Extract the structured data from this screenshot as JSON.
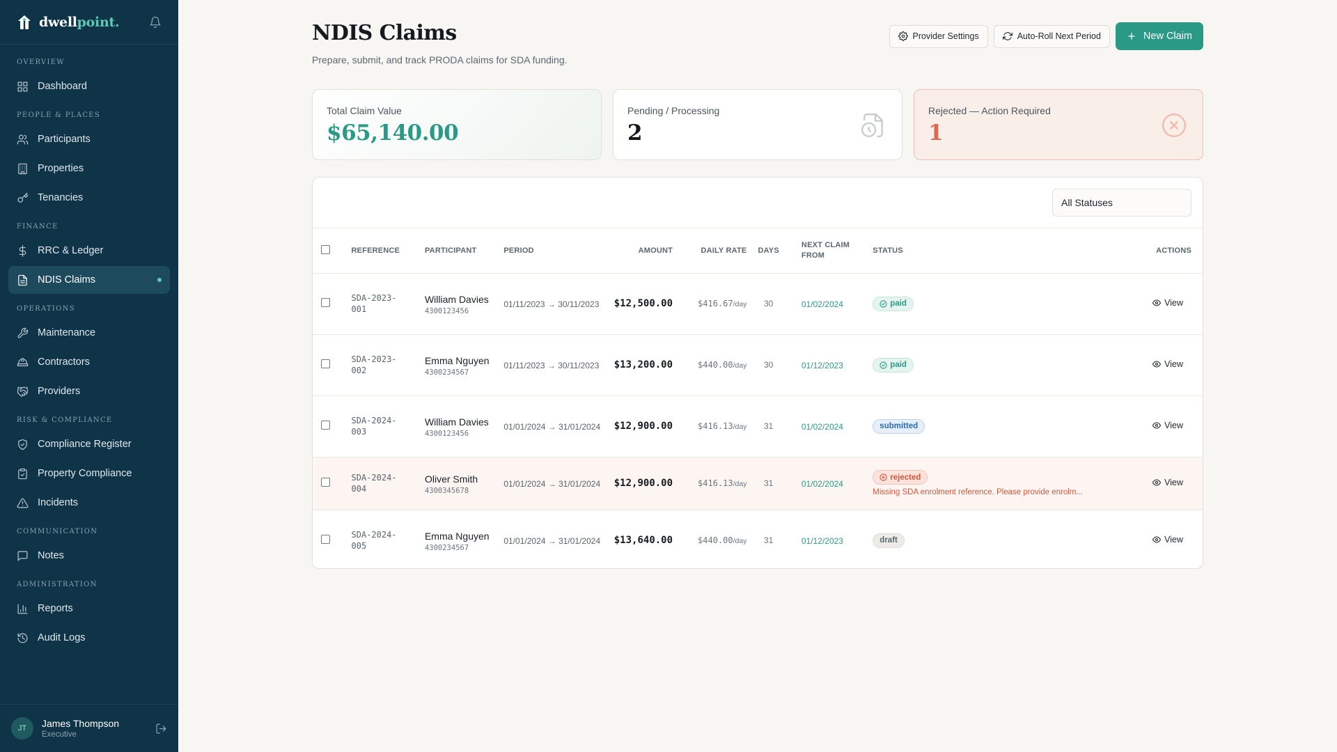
{
  "app": {
    "brand_primary": "dwell",
    "brand_accent": "point.",
    "colors": {
      "sidebar": "#0f3347",
      "accent": "#2a9a87",
      "danger": "#dd6a50"
    }
  },
  "sidebar": {
    "sections": [
      {
        "title": "OVERVIEW",
        "items": [
          {
            "label": "Dashboard",
            "icon": "grid-icon"
          }
        ]
      },
      {
        "title": "PEOPLE & PLACES",
        "items": [
          {
            "label": "Participants",
            "icon": "users-icon"
          },
          {
            "label": "Properties",
            "icon": "building-icon"
          },
          {
            "label": "Tenancies",
            "icon": "key-icon"
          }
        ]
      },
      {
        "title": "FINANCE",
        "items": [
          {
            "label": "RRC & Ledger",
            "icon": "dollar-icon"
          },
          {
            "label": "NDIS Claims",
            "icon": "document-icon",
            "active": true
          }
        ]
      },
      {
        "title": "OPERATIONS",
        "items": [
          {
            "label": "Maintenance",
            "icon": "wrench-icon"
          },
          {
            "label": "Contractors",
            "icon": "hardhat-icon"
          },
          {
            "label": "Providers",
            "icon": "handshake-icon"
          }
        ]
      },
      {
        "title": "RISK & COMPLIANCE",
        "items": [
          {
            "label": "Compliance Register",
            "icon": "shield-icon"
          },
          {
            "label": "Property Compliance",
            "icon": "clipboard-icon"
          },
          {
            "label": "Incidents",
            "icon": "warning-icon"
          }
        ]
      },
      {
        "title": "COMMUNICATION",
        "items": [
          {
            "label": "Notes",
            "icon": "message-icon"
          }
        ]
      },
      {
        "title": "ADMINISTRATION",
        "items": [
          {
            "label": "Reports",
            "icon": "bar-chart-icon"
          },
          {
            "label": "Audit Logs",
            "icon": "history-icon"
          }
        ]
      }
    ],
    "user": {
      "initials": "JT",
      "name": "James Thompson",
      "role": "Executive"
    }
  },
  "header": {
    "title": "NDIS Claims",
    "subtitle": "Prepare, submit, and track PRODA claims for SDA funding.",
    "btn_provider": "Provider Settings",
    "btn_autoroll": "Auto-Roll Next Period",
    "btn_new": "New Claim"
  },
  "cards": {
    "total_label": "Total Claim Value",
    "total_value": "$65,140.00",
    "pending_label": "Pending / Processing",
    "pending_value": "2",
    "rejected_label": "Rejected — Action Required",
    "rejected_value": "1"
  },
  "table": {
    "filter_value": "All Statuses",
    "columns": {
      "reference": "REFERENCE",
      "participant": "PARTICIPANT",
      "period": "PERIOD",
      "amount": "AMOUNT",
      "daily_rate": "DAILY RATE",
      "days": "DAYS",
      "next_claim_1": "NEXT CLAIM",
      "next_claim_2": "FROM",
      "status": "STATUS",
      "actions": "ACTIONS"
    },
    "per_day": "/day",
    "view_label": "View",
    "rows": [
      {
        "ref": "SDA-2023-001",
        "name": "William Davies",
        "ndis": "4300123456",
        "period": "01/11/2023 → 30/11/2023",
        "amount": "$12,500.00",
        "rate": "$416.67",
        "days": "30",
        "next": "01/02/2024",
        "status": "paid",
        "note": ""
      },
      {
        "ref": "SDA-2023-002",
        "name": "Emma Nguyen",
        "ndis": "4300234567",
        "period": "01/11/2023 → 30/11/2023",
        "amount": "$13,200.00",
        "rate": "$440.00",
        "days": "30",
        "next": "01/12/2023",
        "status": "paid",
        "note": ""
      },
      {
        "ref": "SDA-2024-003",
        "name": "William Davies",
        "ndis": "4300123456",
        "period": "01/01/2024 → 31/01/2024",
        "amount": "$12,900.00",
        "rate": "$416.13",
        "days": "31",
        "next": "01/02/2024",
        "status": "submitted",
        "note": ""
      },
      {
        "ref": "SDA-2024-004",
        "name": "Oliver Smith",
        "ndis": "4300345678",
        "period": "01/01/2024 → 31/01/2024",
        "amount": "$12,900.00",
        "rate": "$416.13",
        "days": "31",
        "next": "01/02/2024",
        "status": "rejected",
        "note": "Missing SDA enrolment reference. Please provide enrolm..."
      },
      {
        "ref": "SDA-2024-005",
        "name": "Emma Nguyen",
        "ndis": "4300234567",
        "period": "01/01/2024 → 31/01/2024",
        "amount": "$13,640.00",
        "rate": "$440.00",
        "days": "31",
        "next": "01/12/2023",
        "status": "draft",
        "note": ""
      }
    ]
  }
}
